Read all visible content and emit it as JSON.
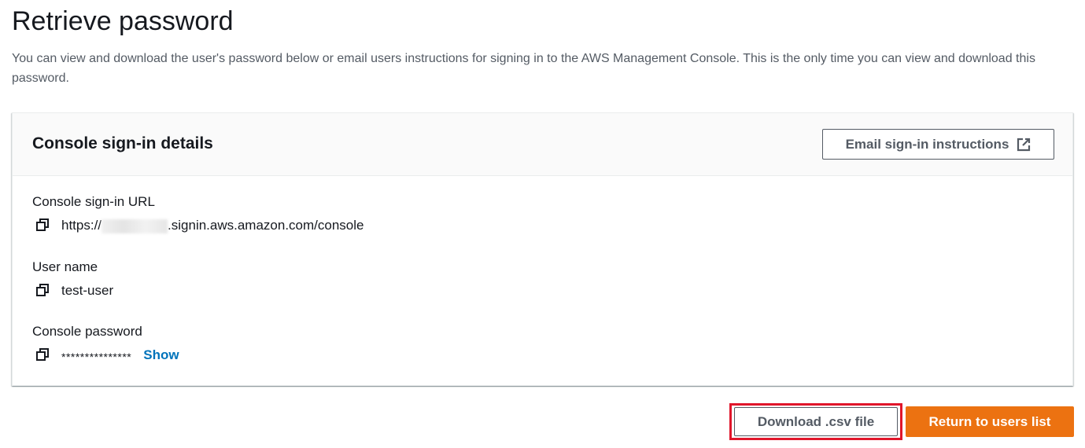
{
  "page": {
    "title": "Retrieve password",
    "description": "You can view and download the user's password below or email users instructions for signing in to the AWS Management Console. This is the only time you can view and download this password."
  },
  "card": {
    "title": "Console sign-in details",
    "email_button_label": "Email sign-in instructions",
    "email_button_icon": "external-link-icon",
    "fields": {
      "url": {
        "label": "Console sign-in URL",
        "prefix": "https://",
        "suffix": ".signin.aws.amazon.com/console",
        "icon": "copy-icon"
      },
      "username": {
        "label": "User name",
        "value": "test-user",
        "icon": "copy-icon"
      },
      "password": {
        "label": "Console password",
        "masked_value": "***************",
        "show_label": "Show",
        "icon": "copy-icon"
      }
    }
  },
  "actions": {
    "download_label": "Download .csv file",
    "return_label": "Return to users list"
  },
  "colors": {
    "primary": "#ec7211",
    "link": "#0073bb",
    "highlight": "#e0162b",
    "text": "#16191f",
    "secondary_text": "#545b64"
  }
}
